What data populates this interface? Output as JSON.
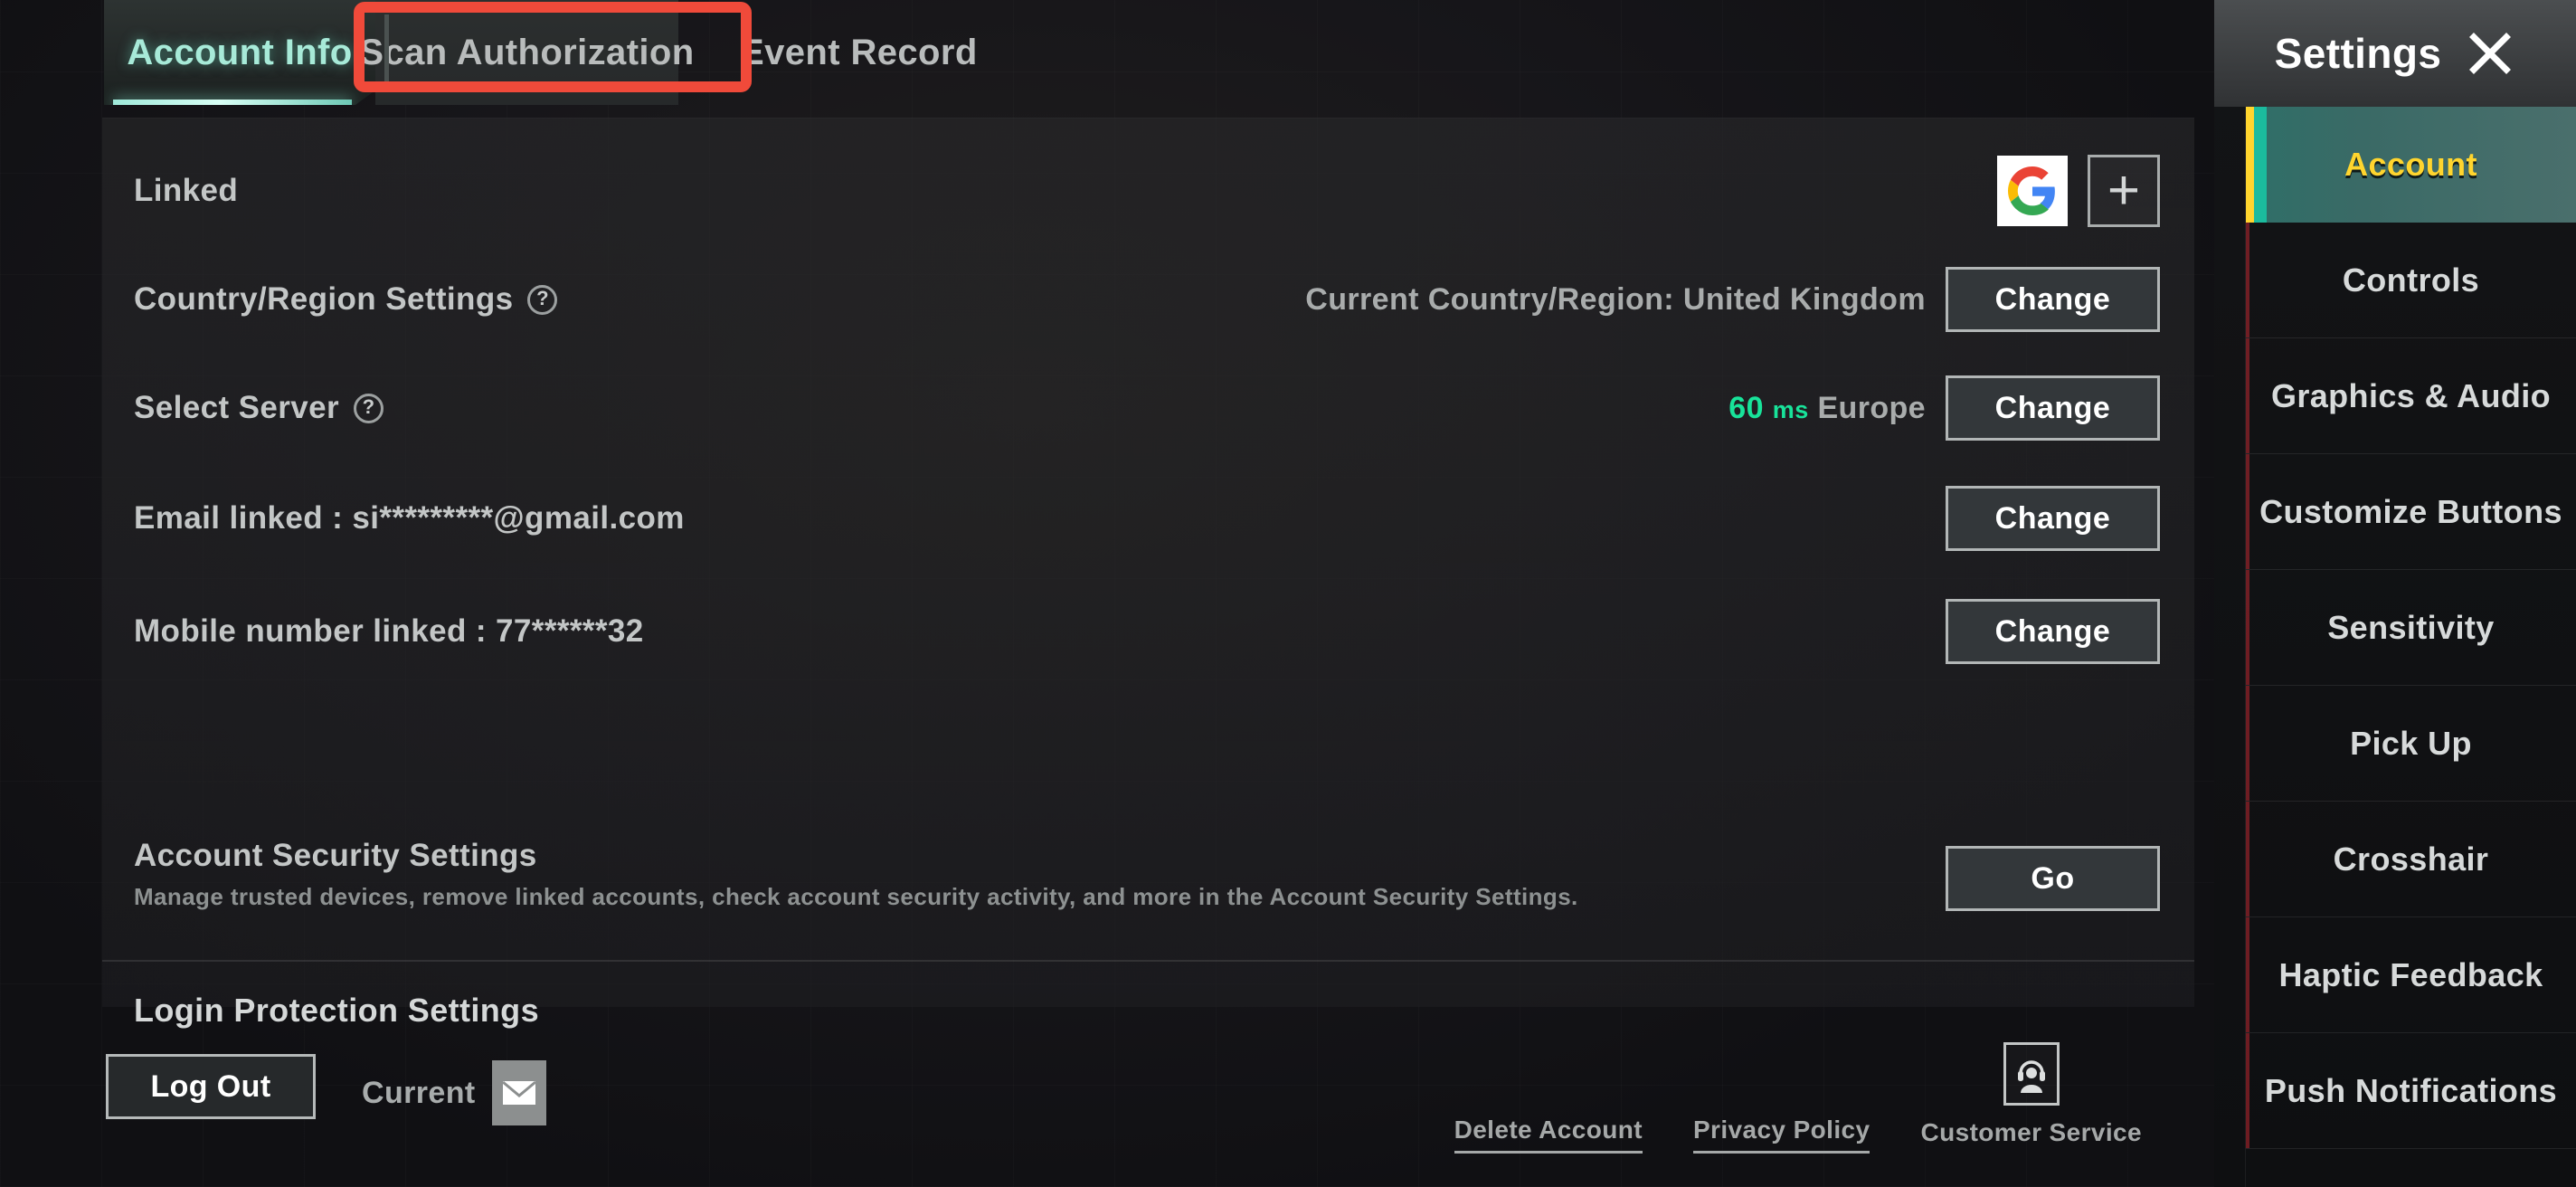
{
  "tabs": [
    {
      "id": "account-info",
      "label": "Account Info",
      "active": true,
      "highlighted": false
    },
    {
      "id": "scan-auth",
      "label": "Scan Authorization",
      "active": false,
      "highlighted": true
    },
    {
      "id": "event-record",
      "label": "Event Record",
      "active": false,
      "highlighted": false
    }
  ],
  "colors": {
    "highlight_red": "#f04a3a",
    "active_tab_teal": "#a7ead8",
    "sidebar_active_text": "#ffd52e",
    "sidebar_active_bg": "#3a6a66",
    "ping_green": "#18e39a"
  },
  "main": {
    "linked": {
      "label": "Linked",
      "google_icon": "google-icon",
      "add_icon": "plus-icon"
    },
    "country_region": {
      "label": "Country/Region Settings",
      "help_icon": "question-mark-icon",
      "value": "Current Country/Region: United Kingdom",
      "button": "Change"
    },
    "select_server": {
      "label": "Select Server",
      "help_icon": "question-mark-icon",
      "ping_value": "60",
      "ping_unit": "ms",
      "server_name": "Europe",
      "button": "Change"
    },
    "email_linked": {
      "label": "Email linked : si*********@gmail.com",
      "button": "Change"
    },
    "mobile_linked": {
      "label": "Mobile number linked : 77******32",
      "button": "Change"
    },
    "account_security": {
      "title": "Account Security Settings",
      "description": "Manage trusted devices, remove linked accounts, check account security activity, and more in the Account Security Settings.",
      "button": "Go"
    },
    "login_protection": {
      "title": "Login Protection Settings"
    }
  },
  "footer": {
    "logout_button": "Log Out",
    "current_label": "Current",
    "current_icon": "envelope-icon",
    "links": [
      {
        "label": "Delete Account",
        "underlined": true
      },
      {
        "label": "Privacy Policy",
        "underlined": true
      }
    ],
    "customer_service": {
      "label": "Customer Service",
      "icon": "headset-support-icon"
    }
  },
  "sidebar": {
    "title": "Settings",
    "close_icon": "close-icon",
    "items": [
      {
        "label": "Account",
        "active": true
      },
      {
        "label": "Controls",
        "active": false
      },
      {
        "label": "Graphics & Audio",
        "active": false
      },
      {
        "label": "Customize Buttons",
        "active": false
      },
      {
        "label": "Sensitivity",
        "active": false
      },
      {
        "label": "Pick Up",
        "active": false
      },
      {
        "label": "Crosshair",
        "active": false
      },
      {
        "label": "Haptic Feedback",
        "active": false
      },
      {
        "label": "Push Notifications",
        "active": false
      }
    ]
  }
}
